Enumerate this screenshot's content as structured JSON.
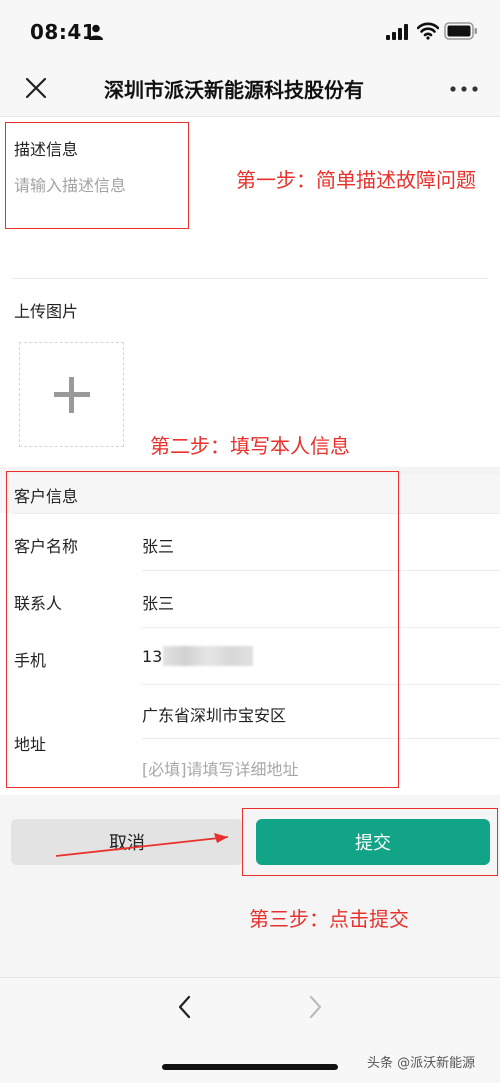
{
  "status_bar": {
    "time": "08:41"
  },
  "nav": {
    "title": "深圳市派沃新能源科技股份有"
  },
  "description": {
    "label": "描述信息",
    "placeholder": "请输入描述信息"
  },
  "upload": {
    "label": "上传图片"
  },
  "customer": {
    "section_title": "客户信息",
    "name_label": "客户名称",
    "name_value": "张三",
    "contact_label": "联系人",
    "contact_value": "张三",
    "phone_label": "手机",
    "phone_value": "13",
    "address_label": "地址",
    "address_region": "广东省深圳市宝安区",
    "address_detail_placeholder": "[必填]请填写详细地址"
  },
  "buttons": {
    "cancel": "取消",
    "submit": "提交"
  },
  "annotations": {
    "step1": "第一步：简单描述故障问题",
    "step2": "第二步：填写本人信息",
    "step3": "第三步：点击提交",
    "color": "#e8312c"
  },
  "watermark": "头条 @派沃新能源",
  "colors": {
    "submit_bg": "#11a487",
    "cancel_bg": "#e3e3e3"
  }
}
